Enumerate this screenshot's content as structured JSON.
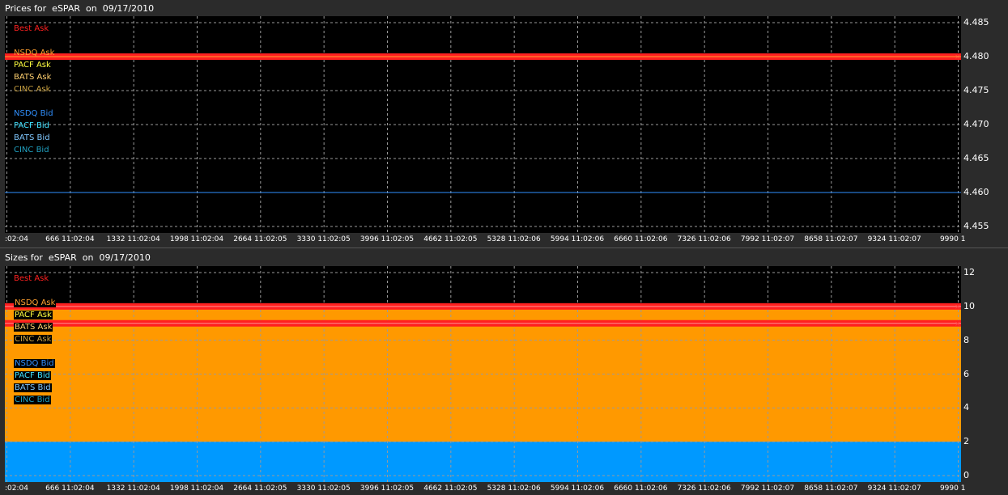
{
  "panels": [
    {
      "title": "Prices for  eSPAR  on  09/17/2010",
      "legend": [
        {
          "label": "Best Ask",
          "color": "#ff2020"
        },
        {
          "label": "NSDQ Ask",
          "color": "#ffa030"
        },
        {
          "label": "PACF Ask",
          "color": "#ffff40"
        },
        {
          "label": "BATS Ask",
          "color": "#ffd070"
        },
        {
          "label": "CINC Ask",
          "color": "#c8a040"
        },
        {
          "label": "NSDQ Bid",
          "color": "#3090ff"
        },
        {
          "label": "PACF Bid",
          "color": "#40e0ff"
        },
        {
          "label": "BATS Bid",
          "color": "#80c8ff"
        },
        {
          "label": "CINC Bid",
          "color": "#20a0c0"
        }
      ]
    },
    {
      "title": "Sizes for  eSPAR  on  09/17/2010",
      "legend": [
        {
          "label": "Best Ask",
          "color": "#ff2020"
        },
        {
          "label": "NSDQ Ask",
          "color": "#ffa030"
        },
        {
          "label": "PACF Ask",
          "color": "#ffff40"
        },
        {
          "label": "BATS Ask",
          "color": "#ffd070"
        },
        {
          "label": "CINC Ask",
          "color": "#c8a040"
        },
        {
          "label": "NSDQ Bid",
          "color": "#3090ff"
        },
        {
          "label": "PACF Bid",
          "color": "#40e0ff"
        },
        {
          "label": "BATS Bid",
          "color": "#80c8ff"
        },
        {
          "label": "CINC Bid",
          "color": "#20a0c0"
        }
      ]
    }
  ],
  "chart_data": [
    {
      "type": "line",
      "title": "Prices for  eSPAR  on  09/17/2010",
      "x_tick_labels": [
        ":02:04",
        "666 11:02:04",
        "1332 11:02:04",
        "1998 11:02:04",
        "2664 11:02:05",
        "3330 11:02:05",
        "3996 11:02:05",
        "4662 11:02:05",
        "5328 11:02:06",
        "5994 11:02:06",
        "6660 11:02:06",
        "7326 11:02:06",
        "7992 11:02:07",
        "8658 11:02:07",
        "9324 11:02:07",
        "9990 1"
      ],
      "y_tick_labels": [
        "4.485",
        "4.480",
        "4.475",
        "4.470",
        "4.465",
        "4.460",
        "4.455"
      ],
      "ylim": [
        4.455,
        4.485
      ],
      "grid": true,
      "series": [
        {
          "name": "Best Ask",
          "color": "#ff2020",
          "value": 4.48,
          "style": "band"
        },
        {
          "name": "NSDQ Ask",
          "color": "#ffa030",
          "value": 4.48
        },
        {
          "name": "NSDQ Bid",
          "color": "#3090ff",
          "value": 4.46
        }
      ]
    },
    {
      "type": "area",
      "title": "Sizes for  eSPAR  on  09/17/2010",
      "x_tick_labels": [
        ":02:04",
        "666 11:02:04",
        "1332 11:02:04",
        "1998 11:02:04",
        "2664 11:02:05",
        "3330 11:02:05",
        "3996 11:02:05",
        "4662 11:02:05",
        "5328 11:02:06",
        "5994 11:02:06",
        "6660 11:02:06",
        "7326 11:02:06",
        "7992 11:02:07",
        "8658 11:02:07",
        "9324 11:02:07",
        "9990 1"
      ],
      "y_tick_labels": [
        "12",
        "10",
        "8",
        "6",
        "4",
        "2",
        "0"
      ],
      "ylim": [
        0,
        12
      ],
      "grid": true,
      "series": [
        {
          "name": "NSDQ Ask",
          "color": "#ff9900",
          "value": 10,
          "style": "area"
        },
        {
          "name": "NSDQ Bid",
          "color": "#0099ff",
          "value": 2,
          "style": "area"
        },
        {
          "name": "Best Ask",
          "color": "#ff2020",
          "value": 10,
          "style": "band"
        },
        {
          "name": "Best Ask",
          "color": "#ff2020",
          "value": 9,
          "style": "band"
        }
      ]
    }
  ]
}
